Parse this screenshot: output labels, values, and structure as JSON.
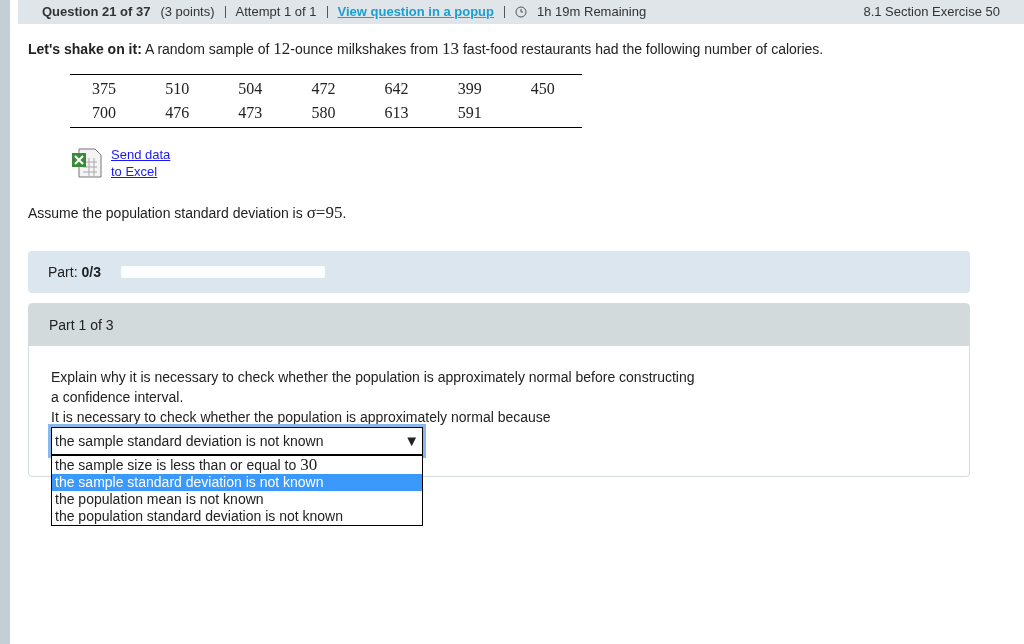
{
  "header": {
    "question": "Question 21 of 37",
    "points": "(3 points)",
    "attempt": "Attempt 1 of 1",
    "popup_link": "View question in a popup",
    "remaining": "1h 19m Remaining",
    "section": "8.1 Section Exercise 50"
  },
  "intro": {
    "lead": "Let's shake on it:",
    "parts": [
      {
        "kind": "text",
        "text": " A random sample of "
      },
      {
        "kind": "math",
        "text": "12"
      },
      {
        "kind": "text",
        "text": "-ounce milkshakes from "
      },
      {
        "kind": "math",
        "text": "13"
      },
      {
        "kind": "text",
        "text": " fast-food restaurants had the following number of calories."
      }
    ]
  },
  "data_table": {
    "rows": [
      [
        "375",
        "510",
        "504",
        "472",
        "642",
        "399",
        "450"
      ],
      [
        "700",
        "476",
        "473",
        "580",
        "613",
        "591",
        ""
      ]
    ]
  },
  "excel_link": {
    "line1": "Send data",
    "line2": "to Excel"
  },
  "assumption": {
    "parts": [
      {
        "kind": "text",
        "text": "Assume the population standard deviation is "
      },
      {
        "kind": "math",
        "text": "σ=95"
      },
      {
        "kind": "text",
        "text": "."
      }
    ]
  },
  "progress": {
    "label": "Part:",
    "value": "0/3",
    "level": 0
  },
  "part": {
    "title": "Part 1 of 3",
    "question": "Explain why it is necessary to check whether the population is approximately normal before constructing a confidence interval.",
    "prompt": "It is necessary to check whether the population is approximately normal because",
    "dropdown": {
      "value": "the sample standard deviation is not known",
      "arrow": "▼",
      "expanded": true,
      "options": [
        {
          "selected": false,
          "parts": [
            {
              "kind": "text",
              "text": "the sample size is less than or equal to "
            },
            {
              "kind": "math",
              "text": "30"
            }
          ]
        },
        {
          "selected": true,
          "parts": [
            {
              "kind": "text",
              "text": "the sample standard deviation is not known"
            }
          ]
        },
        {
          "selected": false,
          "parts": [
            {
              "kind": "text",
              "text": "the population mean is not known"
            }
          ]
        },
        {
          "selected": false,
          "parts": [
            {
              "kind": "text",
              "text": "the population standard deviation is not known"
            }
          ]
        }
      ]
    }
  }
}
